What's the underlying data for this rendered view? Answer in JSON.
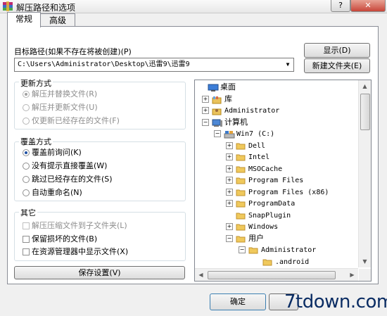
{
  "window": {
    "title": "解压路径和选项",
    "help_button": "?",
    "close_button": "✕"
  },
  "tabs": [
    {
      "label": "常规",
      "active": true
    },
    {
      "label": "高级",
      "active": false
    }
  ],
  "target_path": {
    "label": "目标路径(如果不存在将被创建)(P)",
    "value": "C:\\Users\\Administrator\\Desktop\\迅雷9\\迅雷9"
  },
  "buttons": {
    "show": "显示(D)",
    "new_folder": "新建文件夹(E)",
    "save_settings": "保存设置(V)",
    "ok": "确定"
  },
  "update_mode": {
    "title": "更新方式",
    "options": [
      {
        "label": "解压并替换文件(R)",
        "selected": true,
        "enabled": false
      },
      {
        "label": "解压并更新文件(U)",
        "selected": false,
        "enabled": false
      },
      {
        "label": "仅更新已经存在的文件(F)",
        "selected": false,
        "enabled": false
      }
    ]
  },
  "overwrite_mode": {
    "title": "覆盖方式",
    "options": [
      {
        "label": "覆盖前询问(K)",
        "selected": true
      },
      {
        "label": "没有提示直接覆盖(W)",
        "selected": false
      },
      {
        "label": "跳过已经存在的文件(S)",
        "selected": false
      },
      {
        "label": "自动重命名(N)",
        "selected": false
      }
    ]
  },
  "misc": {
    "title": "其它",
    "options": [
      {
        "label": "解压压缩文件到子文件夹(L)",
        "checked": false,
        "enabled": false
      },
      {
        "label": "保留损坏的文件(B)",
        "checked": false,
        "enabled": true
      },
      {
        "label": "在资源管理器中显示文件(X)",
        "checked": false,
        "enabled": true
      }
    ]
  },
  "tree": {
    "nodes": [
      {
        "label": "桌面",
        "icon": "desktop-icon",
        "expander": "",
        "mono": false
      },
      {
        "label": "库",
        "icon": "library-icon",
        "expander": "+",
        "mono": false
      },
      {
        "label": "Administrator",
        "icon": "user-folder-icon",
        "expander": "+",
        "mono": true
      },
      {
        "label": "计算机",
        "icon": "computer-icon",
        "expander": "−",
        "mono": false
      },
      {
        "label": "Win7 (C:)",
        "icon": "drive-icon",
        "expander": "−",
        "mono": true
      },
      {
        "label": "Dell",
        "icon": "folder-icon",
        "expander": "+",
        "mono": true
      },
      {
        "label": "Intel",
        "icon": "folder-icon",
        "expander": "+",
        "mono": true
      },
      {
        "label": "MSOCache",
        "icon": "folder-icon",
        "expander": "+",
        "mono": true
      },
      {
        "label": "Program Files",
        "icon": "folder-icon",
        "expander": "+",
        "mono": true
      },
      {
        "label": "Program Files (x86)",
        "icon": "folder-icon",
        "expander": "+",
        "mono": true
      },
      {
        "label": "ProgramData",
        "icon": "folder-icon",
        "expander": "+",
        "mono": true
      },
      {
        "label": "SnapPlugin",
        "icon": "folder-icon",
        "expander": "",
        "mono": true
      },
      {
        "label": "Windows",
        "icon": "folder-icon",
        "expander": "+",
        "mono": true
      },
      {
        "label": "用户",
        "icon": "folder-icon",
        "expander": "−",
        "mono": false
      },
      {
        "label": "Administrator",
        "icon": "folder-icon",
        "expander": "−",
        "mono": true
      },
      {
        "label": ".android",
        "icon": "folder-icon",
        "expander": "",
        "mono": true
      }
    ]
  },
  "watermark": "7tdown.com"
}
